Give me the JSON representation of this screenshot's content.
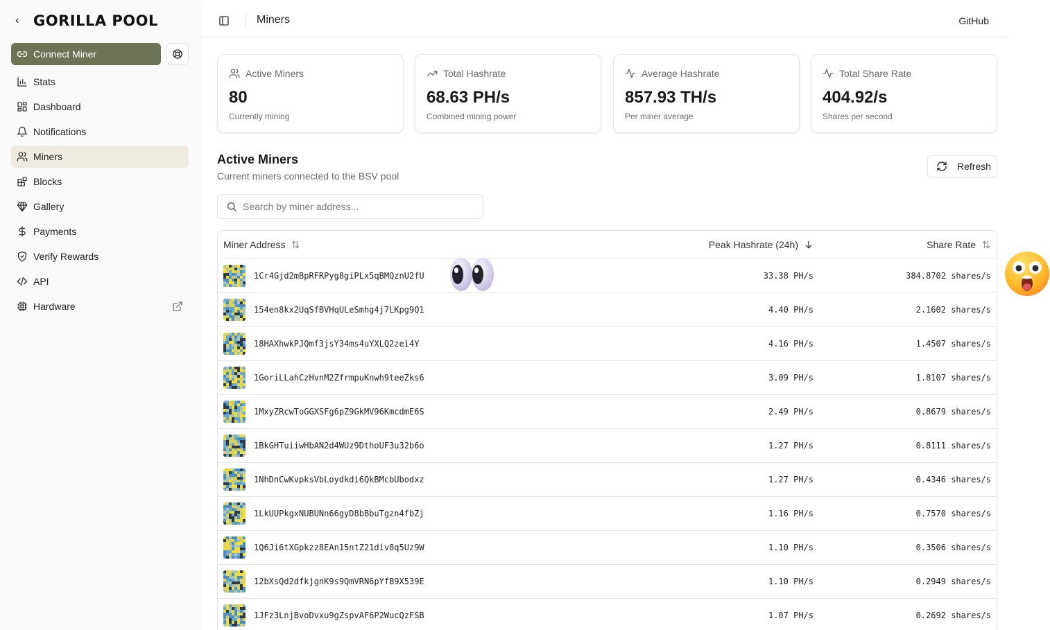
{
  "brand": {
    "back_glyph": "‹",
    "logo_text": "GORILLA POOL"
  },
  "sidebar": {
    "connect_label": "Connect Miner",
    "items": [
      {
        "label": "Stats",
        "icon": "bar-chart-icon"
      },
      {
        "label": "Dashboard",
        "icon": "dashboard-icon"
      },
      {
        "label": "Notifications",
        "icon": "bell-icon"
      },
      {
        "label": "Miners",
        "icon": "users-icon",
        "active": true
      },
      {
        "label": "Blocks",
        "icon": "blocks-icon"
      },
      {
        "label": "Gallery",
        "icon": "gem-icon"
      },
      {
        "label": "Payments",
        "icon": "dollar-icon"
      },
      {
        "label": "Verify Rewards",
        "icon": "shield-check-icon"
      },
      {
        "label": "API",
        "icon": "code-icon"
      },
      {
        "label": "Hardware",
        "icon": "cpu-icon",
        "external": true
      }
    ]
  },
  "header": {
    "breadcrumb": "Miners",
    "github_label": "GitHub"
  },
  "stats": [
    {
      "title": "Active Miners",
      "value": "80",
      "sub": "Currently mining",
      "icon": "users-icon"
    },
    {
      "title": "Total Hashrate",
      "value": "68.63 PH/s",
      "sub": "Combined mining power",
      "icon": "trending-up-icon"
    },
    {
      "title": "Average Hashrate",
      "value": "857.93 TH/s",
      "sub": "Per miner average",
      "icon": "activity-icon"
    },
    {
      "title": "Total Share Rate",
      "value": "404.92/s",
      "sub": "Shares per second",
      "icon": "activity-icon"
    }
  ],
  "section": {
    "title": "Active Miners",
    "subtitle": "Current miners connected to the BSV pool",
    "refresh_label": "Refresh",
    "search_placeholder": "Search by miner address..."
  },
  "table": {
    "columns": [
      "Miner Address",
      "Peak Hashrate (24h)",
      "Share Rate"
    ],
    "rows": [
      {
        "address": "1Cr4Gjd2mBpRFRPyg8giPLx5qBMQznU2fU",
        "hashrate": "33.38 PH/s",
        "share_rate": "384.8702 shares/s"
      },
      {
        "address": "154en8kx2UqSfBVHqULeSmhg4j7LKpg9Q1",
        "hashrate": "4.40 PH/s",
        "share_rate": "2.1602 shares/s"
      },
      {
        "address": "18HAXhwkPJQmf3jsY34ms4uYXLQ2zei4Y",
        "hashrate": "4.16 PH/s",
        "share_rate": "1.4507 shares/s"
      },
      {
        "address": "1GoriLLahCzHvnM2ZfrmpuKnwh9teeZks6",
        "hashrate": "3.09 PH/s",
        "share_rate": "1.8107 shares/s"
      },
      {
        "address": "1MxyZRcwToGGXSFg6pZ9GkMV96KmcdmE6S",
        "hashrate": "2.49 PH/s",
        "share_rate": "0.8679 shares/s"
      },
      {
        "address": "1BkGHTuiiwHbAN2d4WUz9DthoUF3u32b6o",
        "hashrate": "1.27 PH/s",
        "share_rate": "0.8111 shares/s"
      },
      {
        "address": "1NhDnCwKvpksVbLoydkdi6QkBMcbUbodxz",
        "hashrate": "1.27 PH/s",
        "share_rate": "0.4346 shares/s"
      },
      {
        "address": "1LkUUPkgxNUBUNn66gyD8bBbuTgzn4fbZj",
        "hashrate": "1.16 PH/s",
        "share_rate": "0.7570 shares/s"
      },
      {
        "address": "1Q6Ji6tXGpkzz8EAn15ntZ21div8q5Uz9W",
        "hashrate": "1.10 PH/s",
        "share_rate": "0.3506 shares/s"
      },
      {
        "address": "12bXsQd2dfkjgnK9s9QmVRN6pYfB9X539E",
        "hashrate": "1.10 PH/s",
        "share_rate": "0.2949 shares/s"
      },
      {
        "address": "1JFz3LnjBvoDvxu9gZspvAF6P2WucQzFSB",
        "hashrate": "1.07 PH/s",
        "share_rate": "0.2692 shares/s"
      }
    ]
  },
  "colors": {
    "accent": "#6c7455",
    "active_nav": "#efebe0",
    "avatar_palette": [
      "#f2dc3c",
      "#4a8fc4",
      "#a9c6b0",
      "#2e3b44",
      "#d9d25a",
      "#6aa6cf"
    ]
  },
  "overlays": {
    "left": "eyes-emoji-icon",
    "right": "astonished-face-emoji-icon"
  }
}
